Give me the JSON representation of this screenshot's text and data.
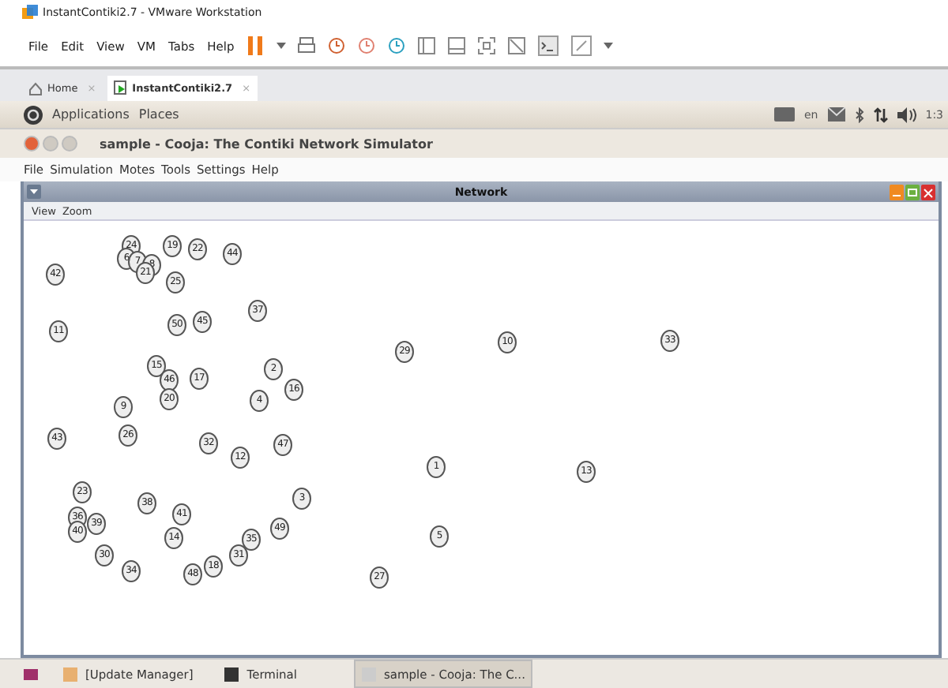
{
  "window": {
    "title": "InstantContiki2.7 - VMware Workstation"
  },
  "menu": [
    "File",
    "Edit",
    "View",
    "VM",
    "Tabs",
    "Help"
  ],
  "tabs": [
    {
      "label": "Home",
      "close": "×",
      "selected": false
    },
    {
      "label": "InstantContiki2.7",
      "close": "×",
      "selected": true
    }
  ],
  "panel": {
    "menus": [
      "Applications",
      "Places"
    ],
    "language": "en",
    "clock": "1:3"
  },
  "app": {
    "title": "sample - Cooja: The Contiki Network Simulator",
    "menu": [
      "File",
      "Simulation",
      "Motes",
      "Tools",
      "Settings",
      "Help"
    ]
  },
  "network": {
    "title": "Network",
    "menu": [
      "View",
      "Zoom"
    ],
    "motes": [
      "24",
      "19",
      "22",
      "44",
      "6",
      "7",
      "8",
      "21",
      "42",
      "25",
      "37",
      "11",
      "50",
      "45",
      "15",
      "2",
      "46",
      "17",
      "16",
      "9",
      "20",
      "4",
      "43",
      "26",
      "32",
      "12",
      "47",
      "23",
      "3",
      "38",
      "41",
      "36",
      "40",
      "39",
      "49",
      "14",
      "35",
      "30",
      "31",
      "34",
      "18",
      "48",
      "27",
      "29",
      "10",
      "33",
      "1",
      "13",
      "5"
    ]
  },
  "taskbar": [
    {
      "label": "[Update Manager]",
      "selected": false
    },
    {
      "label": "Terminal",
      "selected": false
    },
    {
      "label": "sample - Cooja: The C...",
      "selected": true
    }
  ]
}
